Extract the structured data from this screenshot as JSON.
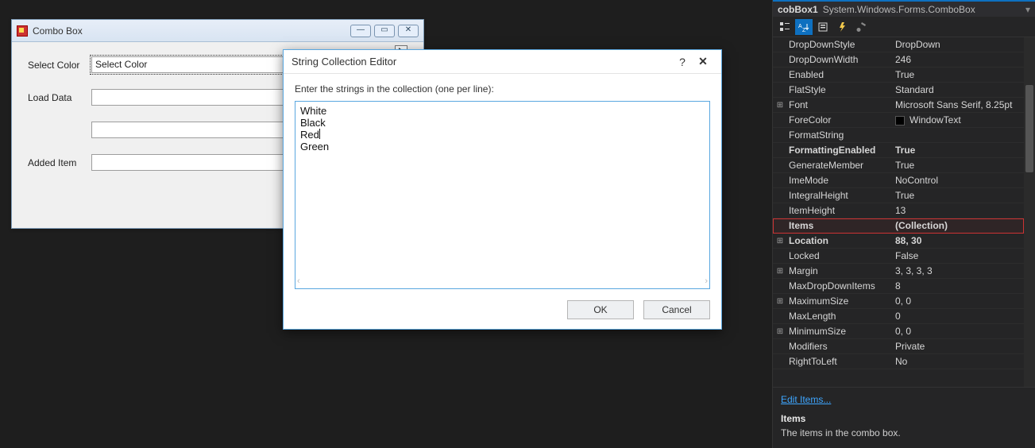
{
  "form": {
    "title": "Combo Box",
    "labels": {
      "select_color": "Select Color",
      "load_data": "Load Data",
      "added_item": "Added Item"
    },
    "combo_select_color_value": "Select Color"
  },
  "dialog": {
    "title": "String Collection Editor",
    "prompt": "Enter the strings in the collection (one per line):",
    "lines": [
      "White",
      "Black",
      "Red",
      "Green"
    ],
    "ok": "OK",
    "cancel": "Cancel"
  },
  "props": {
    "object_name": "cobBox1",
    "object_type": "System.Windows.Forms.ComboBox",
    "rows": [
      {
        "k": "DropDownStyle",
        "v": "DropDown"
      },
      {
        "k": "DropDownWidth",
        "v": "246"
      },
      {
        "k": "Enabled",
        "v": "True"
      },
      {
        "k": "FlatStyle",
        "v": "Standard"
      },
      {
        "k": "Font",
        "v": "Microsoft Sans Serif, 8.25pt",
        "expand": true
      },
      {
        "k": "ForeColor",
        "v": "WindowText",
        "swatch": true
      },
      {
        "k": "FormatString",
        "v": ""
      },
      {
        "k": "FormattingEnabled",
        "v": "True",
        "bold": true
      },
      {
        "k": "GenerateMember",
        "v": "True"
      },
      {
        "k": "ImeMode",
        "v": "NoControl"
      },
      {
        "k": "IntegralHeight",
        "v": "True"
      },
      {
        "k": "ItemHeight",
        "v": "13"
      },
      {
        "k": "Items",
        "v": "(Collection)",
        "bold": true,
        "selected": true
      },
      {
        "k": "Location",
        "v": "88, 30",
        "expand": true,
        "bold": true
      },
      {
        "k": "Locked",
        "v": "False"
      },
      {
        "k": "Margin",
        "v": "3, 3, 3, 3",
        "expand": true
      },
      {
        "k": "MaxDropDownItems",
        "v": "8"
      },
      {
        "k": "MaximumSize",
        "v": "0, 0",
        "expand": true
      },
      {
        "k": "MaxLength",
        "v": "0"
      },
      {
        "k": "MinimumSize",
        "v": "0, 0",
        "expand": true
      },
      {
        "k": "Modifiers",
        "v": "Private"
      },
      {
        "k": "RightToLeft",
        "v": "No"
      }
    ],
    "edit_items": "Edit Items...",
    "desc_name": "Items",
    "desc_text": "The items in the combo box."
  }
}
